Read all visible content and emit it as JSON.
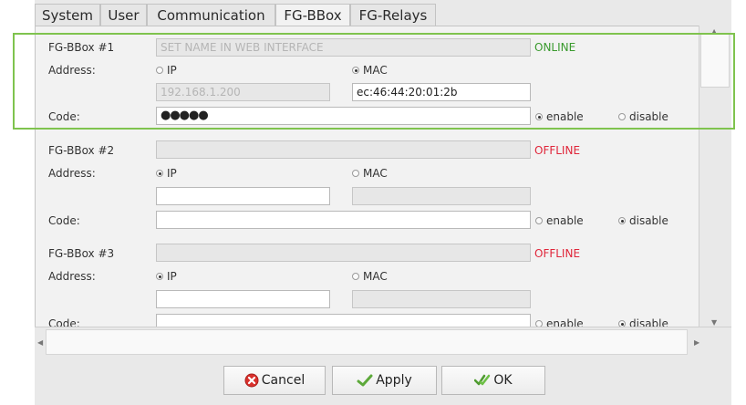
{
  "tabs": [
    "System",
    "User",
    "Communication",
    "FG-BBox",
    "FG-Relays"
  ],
  "active_tab": "FG-BBox",
  "labels": {
    "address": "Address:",
    "code": "Code:",
    "ip": "IP",
    "mac": "MAC",
    "enable": "enable",
    "disable": "disable"
  },
  "boxes": [
    {
      "title": "FG-BBox #1",
      "name_placeholder": "SET NAME IN WEB INTERFACE",
      "name_value": "",
      "status": "ONLINE",
      "status_color": "#3a9a2e",
      "address_mode": "MAC",
      "ip_value": "192.168.1.200",
      "mac_value": "ec:46:44:20:01:2b",
      "code_value": "●●●●●",
      "code_mode": "enable"
    },
    {
      "title": "FG-BBox #2",
      "name_placeholder": "",
      "name_value": "",
      "status": "OFFLINE",
      "status_color": "#e0263a",
      "address_mode": "IP",
      "ip_value": "",
      "mac_value": "",
      "code_value": "",
      "code_mode": "disable"
    },
    {
      "title": "FG-BBox #3",
      "name_placeholder": "",
      "name_value": "",
      "status": "OFFLINE",
      "status_color": "#e0263a",
      "address_mode": "IP",
      "ip_value": "",
      "mac_value": "",
      "code_value": "",
      "code_mode": "disable"
    }
  ],
  "buttons": {
    "cancel": "Cancel",
    "apply": "Apply",
    "ok": "OK"
  },
  "icons": {
    "cancel": "cancel-icon",
    "apply": "checkmark-icon",
    "ok": "ok-checkmark-icon"
  },
  "colors": {
    "highlight": "#7fc34e",
    "online": "#3a9a2e",
    "offline": "#e0263a"
  }
}
